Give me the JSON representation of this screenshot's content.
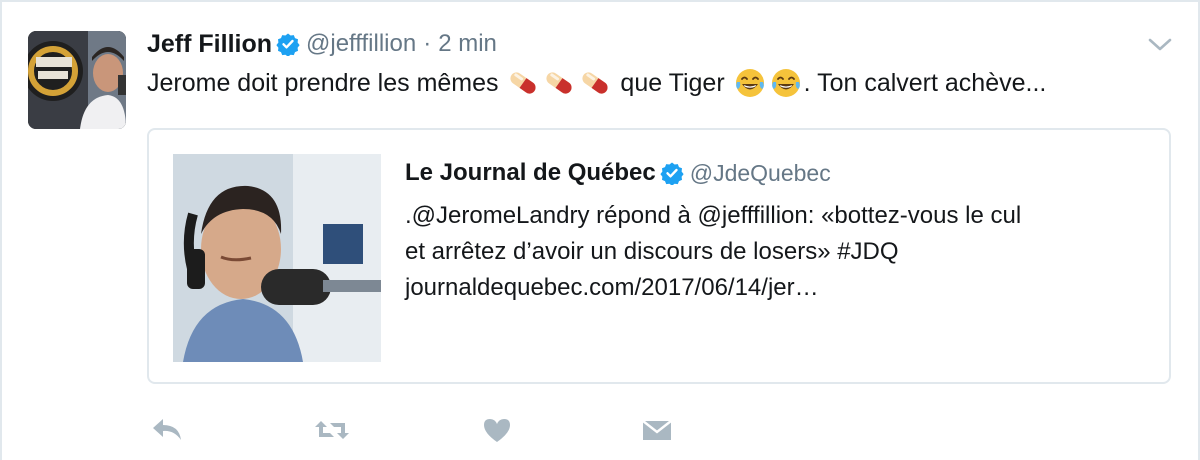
{
  "tweet": {
    "author_name": "Jeff Fillion",
    "author_handle": "@jefffillion",
    "separator": "·",
    "time": "2 min",
    "text_part1": "Jerome doit prendre les mêmes ",
    "text_part2": " que Tiger ",
    "text_part3": ". Ton calvert achève...",
    "icons": [
      "pill-emoji",
      "pill-emoji",
      "pill-emoji",
      "laughing-tears-emoji",
      "laughing-tears-emoji"
    ]
  },
  "quoted": {
    "author_name": "Le Journal de Québec",
    "author_handle": "@JdeQuebec",
    "text_lines": [
      ".@JeromeLandry répond à @jefffillion: «bottez-vous le cul",
      "et arrêtez d’avoir un discours de losers» #JDQ",
      "journaldequebec.com/2017/06/14/jer…"
    ]
  },
  "actions": [
    "reply-icon",
    "retweet-icon",
    "like-icon",
    "direct-message-icon"
  ],
  "colors": {
    "verified": "#1da1f2",
    "muted": "#657786",
    "action_icon": "#aab8c2",
    "border": "#e1e8ed",
    "text": "#14171a"
  }
}
